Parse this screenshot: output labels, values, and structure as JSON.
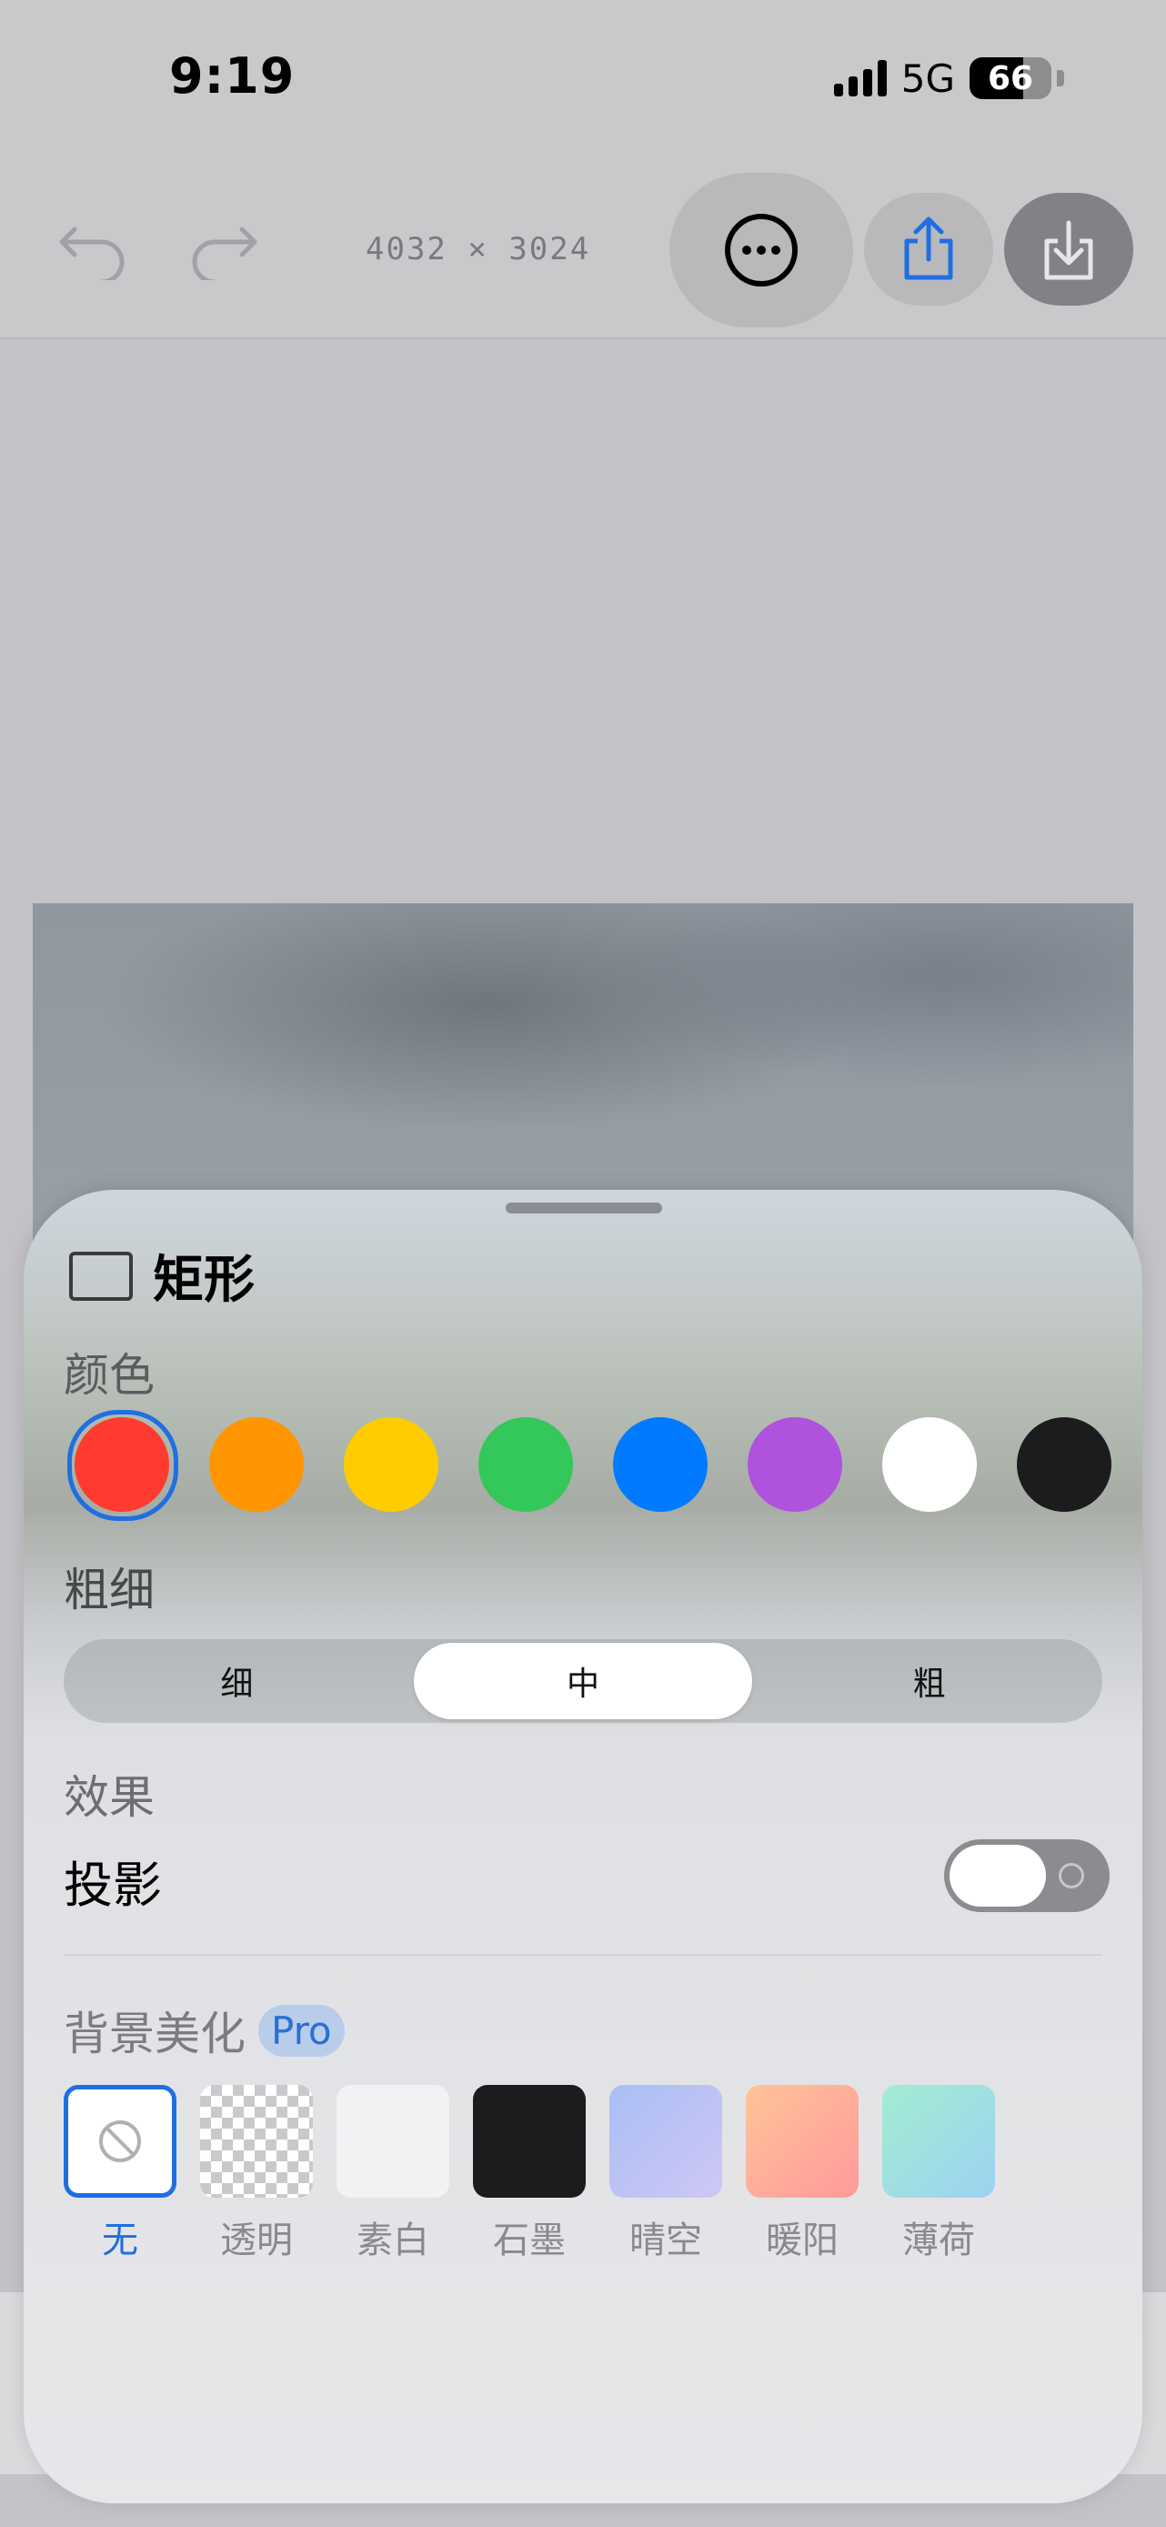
{
  "status_bar": {
    "time": "9:19",
    "network": "5G",
    "battery": 66
  },
  "toolbar": {
    "dimensions": "4032 × 3024"
  },
  "sheet": {
    "title": "矩形",
    "color_label": "颜色",
    "colors": [
      {
        "name": "red",
        "hex": "#ff3b30",
        "selected": true
      },
      {
        "name": "orange",
        "hex": "#ff9500",
        "selected": false
      },
      {
        "name": "yellow",
        "hex": "#ffcc00",
        "selected": false
      },
      {
        "name": "green",
        "hex": "#34c759",
        "selected": false
      },
      {
        "name": "blue",
        "hex": "#007aff",
        "selected": false
      },
      {
        "name": "purple",
        "hex": "#af52de",
        "selected": false
      },
      {
        "name": "white",
        "hex": "#ffffff",
        "selected": false
      },
      {
        "name": "black",
        "hex": "#1c1c1e",
        "selected": false
      }
    ],
    "weight_label": "粗细",
    "weights": [
      "细",
      "中",
      "粗"
    ],
    "selected_weight": "中",
    "effect_label": "效果",
    "shadow_label": "投影",
    "shadow_on": false,
    "background_label": "背景美化",
    "pro_badge": "Pro",
    "backgrounds": [
      {
        "label": "无",
        "selected": true
      },
      {
        "label": "透明",
        "selected": false
      },
      {
        "label": "素白",
        "selected": false
      },
      {
        "label": "石墨",
        "selected": false
      },
      {
        "label": "晴空",
        "selected": false
      },
      {
        "label": "暖阳",
        "selected": false
      },
      {
        "label": "薄荷",
        "selected": false
      }
    ]
  }
}
